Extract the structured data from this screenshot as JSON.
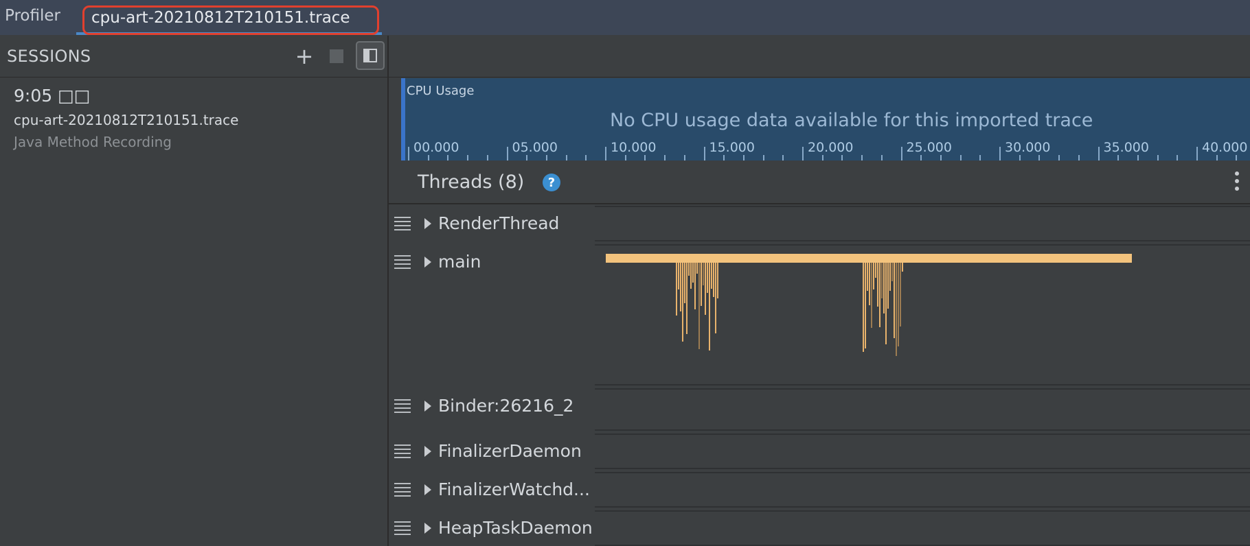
{
  "tabs": {
    "profiler": "Profiler",
    "trace": "cpu-art-20210812T210151.trace"
  },
  "sessions": {
    "title": "SESSIONS",
    "add_icon": "+",
    "item": {
      "time": "9:05 □□",
      "name": "cpu-art-20210812T210151.trace",
      "type": "Java Method Recording"
    }
  },
  "cpu": {
    "label": "CPU Usage",
    "message": "No CPU usage data available for this imported trace",
    "ticks": [
      "00.000",
      "05.000",
      "10.000",
      "15.000",
      "20.000",
      "25.000",
      "30.000",
      "35.000",
      "40.000"
    ]
  },
  "threads": {
    "title": "Threads (8)",
    "help_icon": "?",
    "rows": [
      {
        "name": "RenderThread"
      },
      {
        "name": "main"
      },
      {
        "name": "Binder:26216_2"
      },
      {
        "name": "FinalizerDaemon"
      },
      {
        "name": "FinalizerWatchd..."
      },
      {
        "name": "HeapTaskDaemon"
      }
    ]
  },
  "colors": {
    "accent": "#4a88c7",
    "highlight": "#e2402e",
    "cpu_panel": "#294b6a",
    "method_bar": "#f3c37d"
  }
}
